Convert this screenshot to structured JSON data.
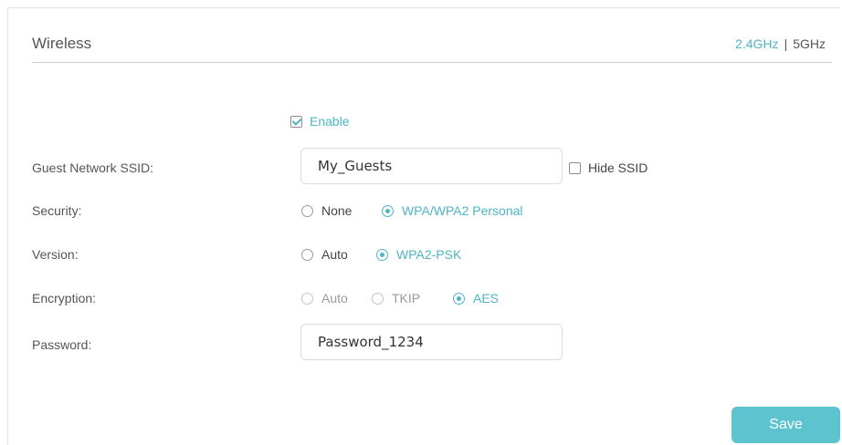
{
  "section": {
    "title": "Wireless",
    "bands": [
      {
        "label": "2.4GHz",
        "active": true
      },
      {
        "label": "5GHz",
        "active": false
      }
    ],
    "band_separator": "|"
  },
  "enable": {
    "label": "Enable",
    "checked": true
  },
  "ssid": {
    "label": "Guest Network SSID:",
    "value": "My_Guests",
    "hide_label": "Hide SSID",
    "hide_checked": false
  },
  "security": {
    "label": "Security:",
    "options": [
      {
        "label": "None",
        "selected": false
      },
      {
        "label": "WPA/WPA2 Personal",
        "selected": true
      }
    ]
  },
  "version": {
    "label": "Version:",
    "options": [
      {
        "label": "Auto",
        "selected": false
      },
      {
        "label": "WPA2-PSK",
        "selected": true
      }
    ]
  },
  "encryption": {
    "label": "Encryption:",
    "options": [
      {
        "label": "Auto",
        "selected": false,
        "disabled": true
      },
      {
        "label": "TKIP",
        "selected": false,
        "disabled": true
      },
      {
        "label": "AES",
        "selected": true,
        "disabled": false
      }
    ]
  },
  "password": {
    "label": "Password:",
    "value": "Password_1234"
  },
  "save_label": "Save",
  "colors": {
    "accent": "#4db5c5",
    "button": "#5cc3cf"
  }
}
